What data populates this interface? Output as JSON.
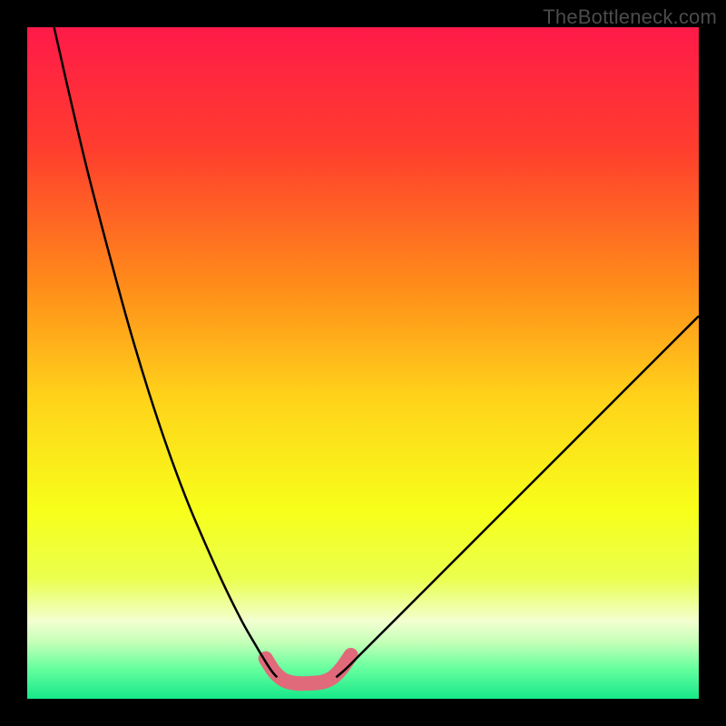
{
  "watermark": {
    "text": "TheBottleneck.com"
  },
  "chart_data": {
    "type": "line",
    "title": "",
    "xlabel": "",
    "ylabel": "",
    "xlim": [
      0,
      100
    ],
    "ylim": [
      0,
      100
    ],
    "grid": false,
    "legend": false,
    "gradient_stops": [
      {
        "offset": 0.0,
        "color": "#ff1a49"
      },
      {
        "offset": 0.18,
        "color": "#ff3d2e"
      },
      {
        "offset": 0.38,
        "color": "#ff8a1a"
      },
      {
        "offset": 0.55,
        "color": "#ffd21a"
      },
      {
        "offset": 0.72,
        "color": "#f7ff1a"
      },
      {
        "offset": 0.82,
        "color": "#eaff4d"
      },
      {
        "offset": 0.885,
        "color": "#f2ffd1"
      },
      {
        "offset": 0.915,
        "color": "#c6ffb8"
      },
      {
        "offset": 0.955,
        "color": "#66ff9e"
      },
      {
        "offset": 1.0,
        "color": "#17e88a"
      }
    ],
    "series": [
      {
        "name": "bottleneck-curve-left",
        "stroke": "#000000",
        "stroke_width": 2.5,
        "x": [
          4.0,
          6.5,
          9.0,
          12.0,
          15.0,
          18.0,
          21.0,
          24.0,
          27.0,
          29.5,
          32.0,
          34.0,
          35.5,
          36.5,
          37.2
        ],
        "y": [
          100.0,
          89.0,
          78.5,
          67.0,
          56.0,
          46.0,
          37.0,
          29.0,
          22.0,
          16.5,
          11.5,
          8.0,
          5.5,
          4.0,
          3.2
        ]
      },
      {
        "name": "bottleneck-curve-right",
        "stroke": "#000000",
        "stroke_width": 2.5,
        "x": [
          46.0,
          47.5,
          49.5,
          52.0,
          55.0,
          59.0,
          63.5,
          68.5,
          74.0,
          80.0,
          86.5,
          93.0,
          100.0
        ],
        "y": [
          3.2,
          4.5,
          6.5,
          9.0,
          12.0,
          16.0,
          20.5,
          25.5,
          31.0,
          37.0,
          43.5,
          50.0,
          57.0
        ]
      },
      {
        "name": "near-bottom-highlight",
        "stroke": "#e06a7a",
        "stroke_width": 16,
        "linecap": "round",
        "x": [
          35.5,
          36.8,
          38.2,
          40.0,
          42.0,
          44.0,
          45.5,
          46.8,
          48.2
        ],
        "y": [
          6.0,
          4.0,
          2.8,
          2.3,
          2.3,
          2.5,
          3.2,
          4.5,
          6.5
        ]
      }
    ]
  }
}
